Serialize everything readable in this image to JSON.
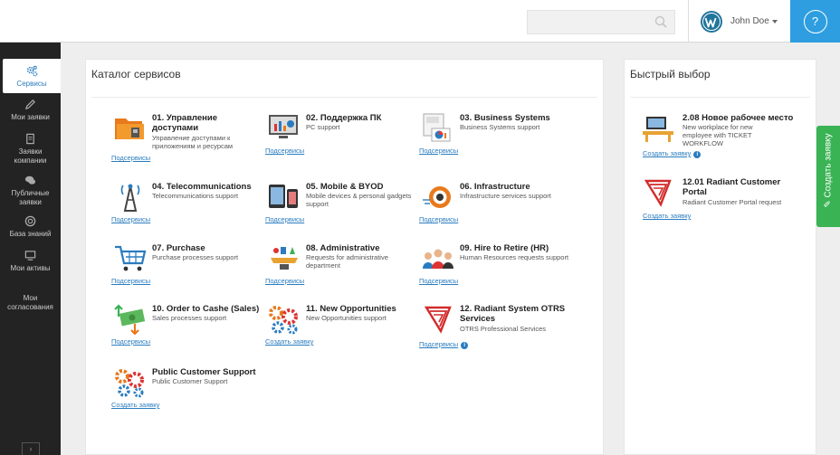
{
  "colors": {
    "accent": "#2e9ee0",
    "sidebar": "#232323",
    "link": "#2a7cbf",
    "create_ticket": "#39b354"
  },
  "header": {
    "search": {
      "placeholder": "",
      "icon": "search-icon"
    },
    "user": {
      "name": "John Doe",
      "icon": "wordpress-icon"
    },
    "help": {
      "label": "?"
    }
  },
  "sidebar": {
    "items": [
      {
        "label": "Сервисы",
        "icon": "gears-icon",
        "active": true
      },
      {
        "label": "Мои заявки",
        "icon": "pen-icon"
      },
      {
        "label": "Заявки компании",
        "icon": "document-icon"
      },
      {
        "label": "Публичные заявки",
        "icon": "chat-icon"
      },
      {
        "label": "База знаний",
        "icon": "lifebuoy-icon"
      },
      {
        "label": "Мои активы",
        "icon": "monitor-icon"
      },
      {
        "label": "Мои согласования",
        "icon": ""
      }
    ],
    "toggle": "›"
  },
  "catalog": {
    "title": "Каталог сервисов",
    "services": [
      {
        "title": "01. Управление доступами",
        "desc": "Управление доступами к приложениям и ресурсам",
        "link": "Подсервисы",
        "icon": "folder-icon"
      },
      {
        "title": "02. Поддержка ПК",
        "desc": "PC support",
        "link": "Подсервисы",
        "icon": "monitor-chart-icon"
      },
      {
        "title": "03. Business Systems",
        "desc": "Business Systems support",
        "link": "Подсервисы",
        "icon": "business-charts-icon"
      },
      {
        "title": "04. Telecommunications",
        "desc": "Telecommunications support",
        "link": "Подсервисы",
        "icon": "antenna-tower-icon"
      },
      {
        "title": "05. Mobile & BYOD",
        "desc": "Mobile devices & personal gadgets support",
        "link": "Подсервисы",
        "icon": "mobile-devices-icon"
      },
      {
        "title": "06. Infrastructure",
        "desc": "Infrastructure services support",
        "link": "Подсервисы",
        "icon": "robot-icon"
      },
      {
        "title": "07. Purchase",
        "desc": "Purchase processes support",
        "link": "Подсервисы",
        "icon": "shopping-cart-icon"
      },
      {
        "title": "08. Administrative",
        "desc": "Requests for administrative department",
        "link": "Подсервисы",
        "icon": "administrative-tray-icon"
      },
      {
        "title": "09. Hire to Retire (HR)",
        "desc": "Human Resources requests support",
        "link": "Подсервисы",
        "icon": "people-icon"
      },
      {
        "title": "10. Order to Cashe (Sales)",
        "desc": "Sales processes support",
        "link": "Подсервисы",
        "icon": "money-arrows-icon"
      },
      {
        "title": "11. New Opportunities",
        "desc": "New Opportunities support",
        "link": "Создать заявку",
        "icon": "gears-color-icon"
      },
      {
        "title": "12. Radiant System OTRS Services",
        "desc": "OTRS Professional Services",
        "link": "Подсервисы",
        "icon": "radiant-logo-icon",
        "info": "i"
      },
      {
        "title": "Public Customer Support",
        "desc": "Public Customer Support",
        "link": "Создать заявку",
        "icon": "gears-color-icon"
      }
    ]
  },
  "quick": {
    "title": "Быстрый выбор",
    "items": [
      {
        "title": "2.08 Новое рабочее место",
        "desc": "New workplace for new employee with TICKET WORKFLOW",
        "link": "Создать заявку",
        "icon": "workplace-icon",
        "info": "i"
      },
      {
        "title": "12.01 Radiant Customer Portal",
        "desc": "Radiant Customer Portal request",
        "link": "Создать заявку",
        "icon": "radiant-logo-icon"
      }
    ]
  },
  "create_ticket": {
    "label": "Создать заявку",
    "icon": "pencil-icon"
  }
}
